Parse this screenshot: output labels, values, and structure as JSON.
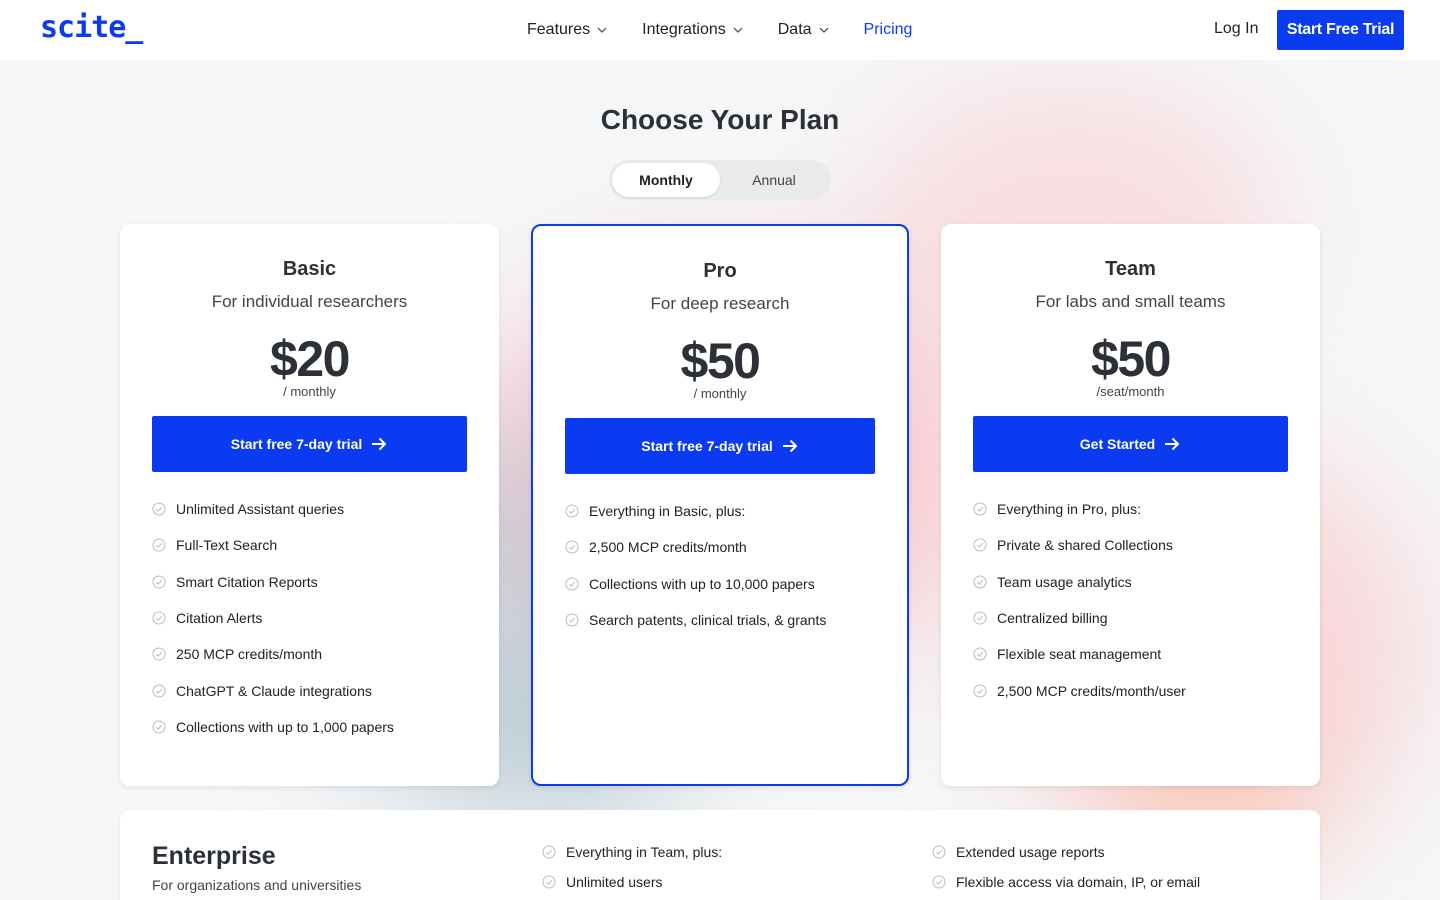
{
  "header": {
    "logo": "scite_",
    "nav": [
      {
        "label": "Features",
        "has_dropdown": true
      },
      {
        "label": "Integrations",
        "has_dropdown": true
      },
      {
        "label": "Data",
        "has_dropdown": true
      },
      {
        "label": "Pricing",
        "has_dropdown": false,
        "active": true
      }
    ],
    "login": "Log In",
    "trial": "Start Free Trial"
  },
  "title": "Choose Your Plan",
  "billing_toggle": {
    "options": [
      "Monthly",
      "Annual"
    ],
    "selected": "Monthly"
  },
  "plans": [
    {
      "name": "Basic",
      "subtitle": "For individual researchers",
      "price": "$20",
      "period": "/ monthly",
      "cta": "Start free 7-day trial",
      "features": [
        "Unlimited Assistant queries",
        "Full-Text Search",
        "Smart Citation Reports",
        "Citation Alerts",
        "250 MCP credits/month",
        "ChatGPT & Claude integrations",
        "Collections with up to 1,000 papers"
      ]
    },
    {
      "name": "Pro",
      "subtitle": "For deep research",
      "price": "$50",
      "period": "/ monthly",
      "cta": "Start free 7-day trial",
      "features": [
        "Everything in Basic, plus:",
        "2,500 MCP credits/month",
        "Collections with up to 10,000 papers",
        "Search patents, clinical trials, & grants"
      ]
    },
    {
      "name": "Team",
      "subtitle": "For labs and small teams",
      "price": "$50",
      "period": "/seat/month",
      "cta": "Get Started",
      "features": [
        "Everything in Pro, plus:",
        "Private & shared Collections",
        "Team usage analytics",
        "Centralized billing",
        "Flexible seat management",
        "2,500 MCP credits/month/user"
      ]
    }
  ],
  "enterprise": {
    "name": "Enterprise",
    "subtitle": "For organizations and universities",
    "features_col1": [
      "Everything in Team, plus:",
      "Unlimited users"
    ],
    "features_col2": [
      "Extended usage reports",
      "Flexible access via domain, IP, or email"
    ]
  },
  "colors": {
    "brand": "#0b3bf0",
    "text": "#2c3138"
  },
  "icons": {
    "nav_dropdown": "chevron-down-icon",
    "cta_arrow": "arrow-right-icon",
    "feature_check": "check-circle-icon"
  }
}
